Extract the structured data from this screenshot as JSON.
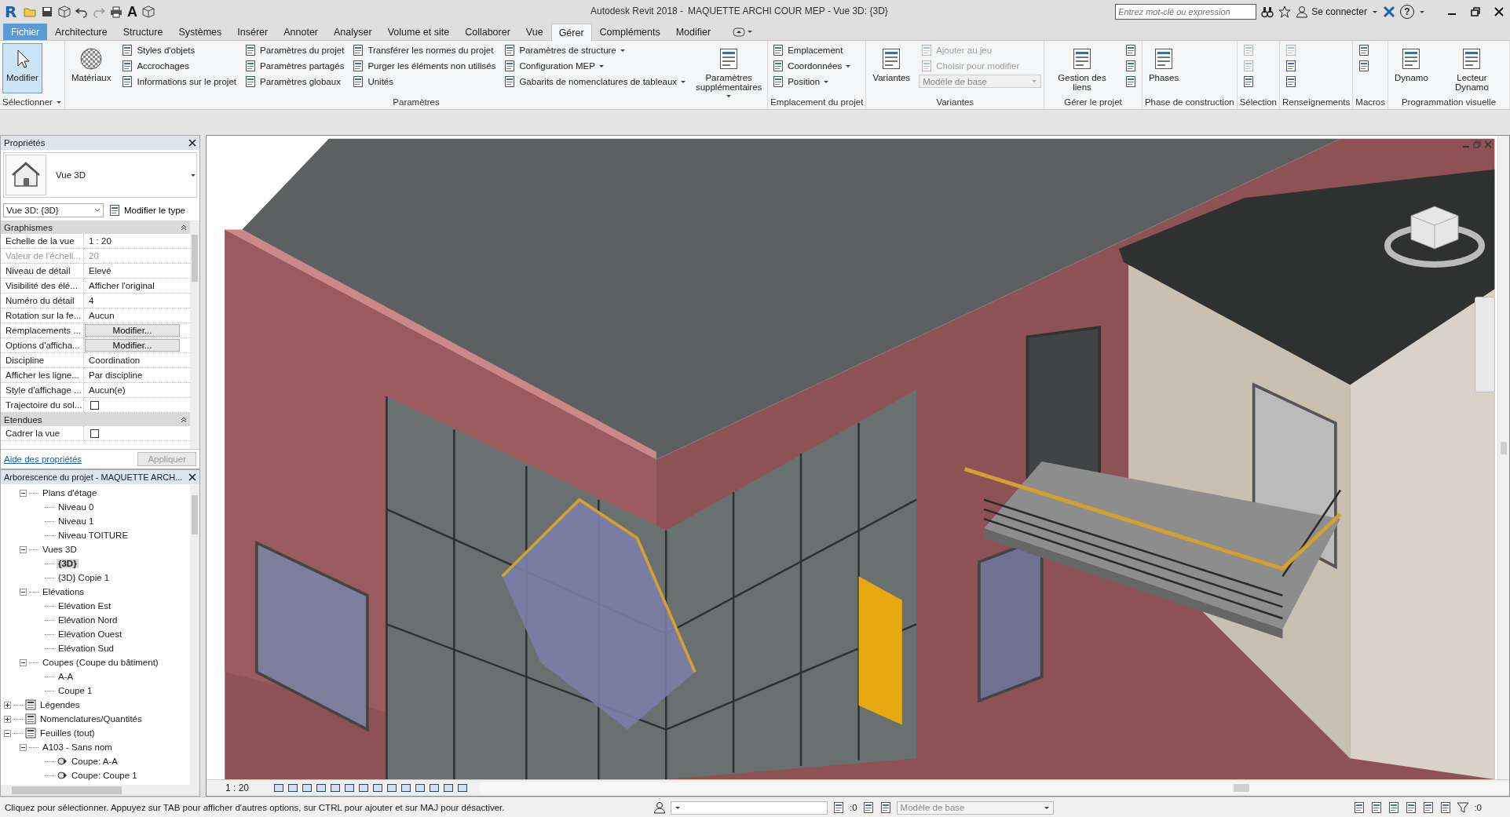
{
  "title_bar": {
    "logo": "R",
    "text_tool": "A",
    "app_title": "Autodesk Revit 2018 -",
    "document_title": "MAQUETTE ARCHI COUR MEP - Vue 3D: {3D}",
    "search": {
      "placeholder": "Entrez mot-clé ou expression"
    },
    "sign_in": "Se connecter",
    "help": "?"
  },
  "ribbon_tabs": [
    {
      "label": "Fichier",
      "kind": "file",
      "selected": false
    },
    {
      "label": "Architecture",
      "kind": "tab",
      "selected": false
    },
    {
      "label": "Structure",
      "kind": "tab",
      "selected": false
    },
    {
      "label": "Systèmes",
      "kind": "tab",
      "selected": false
    },
    {
      "label": "Insérer",
      "kind": "tab",
      "selected": false
    },
    {
      "label": "Annoter",
      "kind": "tab",
      "selected": false
    },
    {
      "label": "Analyser",
      "kind": "tab",
      "selected": false
    },
    {
      "label": "Volume et site",
      "kind": "tab",
      "selected": false
    },
    {
      "label": "Collaborer",
      "kind": "tab",
      "selected": false
    },
    {
      "label": "Vue",
      "kind": "tab",
      "selected": false
    },
    {
      "label": "Gérer",
      "kind": "tab",
      "selected": true
    },
    {
      "label": "Compléments",
      "kind": "tab",
      "selected": false
    },
    {
      "label": "Modifier",
      "kind": "tab",
      "selected": false
    }
  ],
  "ribbon_panels": [
    {
      "title": "Sélectionner",
      "dropdown": true,
      "columns": [
        [
          {
            "kind": "toggle",
            "label": "Modifier",
            "active": true,
            "disabled": false
          }
        ]
      ]
    },
    {
      "title": "Paramètres",
      "columns": [
        [
          {
            "kind": "large",
            "label": "Matériaux",
            "disabled": false
          }
        ],
        [
          {
            "kind": "small",
            "label": "Styles d'objets",
            "disabled": false
          },
          {
            "kind": "small",
            "label": "Accrochages",
            "disabled": false
          },
          {
            "kind": "small",
            "label": "Informations sur le projet",
            "disabled": false
          }
        ],
        [
          {
            "kind": "small",
            "label": "Paramètres du projet",
            "disabled": false
          },
          {
            "kind": "small",
            "label": "Paramètres partagés",
            "disabled": false
          },
          {
            "kind": "small",
            "label": "Paramètres globaux",
            "disabled": false
          }
        ],
        [
          {
            "kind": "small",
            "label": "Transférer les normes du projet",
            "disabled": false
          },
          {
            "kind": "small",
            "label": "Purger les éléments non utilisés",
            "disabled": false
          },
          {
            "kind": "small",
            "label": "Unités",
            "disabled": false
          }
        ],
        [
          {
            "kind": "small",
            "label": "Paramètres de structure",
            "dropdown": true,
            "disabled": false
          },
          {
            "kind": "small",
            "label": "Configuration MEP",
            "dropdown": true,
            "disabled": false
          },
          {
            "kind": "small",
            "label": "Gabarits de nomenclatures de tableaux",
            "dropdown": true,
            "disabled": false
          }
        ],
        [
          {
            "kind": "large",
            "label": "Paramètres supplémentaires",
            "dropdown": true,
            "disabled": false
          }
        ]
      ]
    },
    {
      "title": "Emplacement du projet",
      "columns": [
        [
          {
            "kind": "small",
            "label": "Emplacement",
            "disabled": false
          },
          {
            "kind": "small",
            "label": "Coordonnées",
            "dropdown": true,
            "disabled": false
          },
          {
            "kind": "small",
            "label": "Position",
            "dropdown": true,
            "disabled": false
          }
        ]
      ]
    },
    {
      "title": "Variantes",
      "columns": [
        [
          {
            "kind": "large",
            "label": "Variantes",
            "disabled": false
          }
        ],
        [
          {
            "kind": "small",
            "label": "Ajouter au jeu",
            "disabled": true
          },
          {
            "kind": "small",
            "label": "Choisir pour modifier",
            "disabled": true
          },
          {
            "kind": "combo",
            "label": "Modèle de base",
            "disabled": true
          }
        ]
      ]
    },
    {
      "title": "Gérer le projet",
      "columns": [
        [
          {
            "kind": "large",
            "label": "Gestion des liens",
            "disabled": false
          }
        ],
        [
          {
            "kind": "icon",
            "disabled": false
          },
          {
            "kind": "icon",
            "disabled": false
          },
          {
            "kind": "icon",
            "disabled": false
          }
        ]
      ]
    },
    {
      "title": "Phase de construction",
      "columns": [
        [
          {
            "kind": "large",
            "label": "Phases",
            "disabled": false
          }
        ]
      ]
    },
    {
      "title": "Sélection",
      "columns": [
        [
          {
            "kind": "icon",
            "disabled": true
          },
          {
            "kind": "icon",
            "disabled": true
          },
          {
            "kind": "icon",
            "disabled": false
          }
        ]
      ]
    },
    {
      "title": "Renseignements",
      "columns": [
        [
          {
            "kind": "icon",
            "disabled": true
          },
          {
            "kind": "icon",
            "disabled": false
          },
          {
            "kind": "icon",
            "disabled": false
          }
        ]
      ]
    },
    {
      "title": "Macros",
      "columns": [
        [
          {
            "kind": "icon",
            "disabled": false
          },
          {
            "kind": "icon",
            "disabled": false
          }
        ]
      ]
    },
    {
      "title": "Programmation visuelle",
      "columns": [
        [
          {
            "kind": "large",
            "label": "Dynamo",
            "disabled": false
          }
        ],
        [
          {
            "kind": "large",
            "label": "Lecteur Dynamo",
            "disabled": false
          }
        ]
      ]
    }
  ],
  "properties": {
    "title": "Propriétés",
    "type_name": "Vue 3D",
    "instance_selector": "Vue 3D: {3D}",
    "edit_type": "Modifier le type",
    "groups": [
      {
        "title": "Graphismes",
        "rows": [
          {
            "kind": "text",
            "name": "Echelle de la vue",
            "value": "1 : 20",
            "disabled": false
          },
          {
            "kind": "text",
            "name": "Valeur de l'échell...",
            "value": "20",
            "disabled": true
          },
          {
            "kind": "text",
            "name": "Niveau de détail",
            "value": "Elevé",
            "disabled": false
          },
          {
            "kind": "text",
            "name": "Visibilité des élé...",
            "value": "Afficher l'original",
            "disabled": false
          },
          {
            "kind": "text",
            "name": "Numéro du détail",
            "value": "4",
            "disabled": false
          },
          {
            "kind": "text",
            "name": "Rotation sur la fe...",
            "value": "Aucun",
            "disabled": false
          },
          {
            "kind": "button",
            "name": "Remplacements ...",
            "value": "Modifier...",
            "disabled": false
          },
          {
            "kind": "button",
            "name": "Options d'afficha...",
            "value": "Modifier...",
            "disabled": false
          },
          {
            "kind": "text",
            "name": "Discipline",
            "value": "Coordination",
            "disabled": false
          },
          {
            "kind": "text",
            "name": "Afficher les ligne...",
            "value": "Par discipline",
            "disabled": false
          },
          {
            "kind": "text",
            "name": "Style d'affichage ...",
            "value": "Aucun(e)",
            "disabled": false
          },
          {
            "kind": "checkbox",
            "name": "Trajectoire du sol...",
            "checked": false,
            "disabled": false
          }
        ]
      },
      {
        "title": "Etendues",
        "rows": [
          {
            "kind": "checkbox",
            "name": "Cadrer la vue",
            "checked": false,
            "disabled": false
          }
        ]
      }
    ],
    "help_link": "Aide des propriétés",
    "apply": {
      "label": "Appliquer",
      "disabled": true
    }
  },
  "project_browser": {
    "title": "Arborescence du projet - MAQUETTE ARCH...",
    "tree": [
      {
        "kind": "hidden",
        "children": [
          {
            "kind": "folder",
            "label": "Plans d'étage",
            "expanded": true,
            "selected": false,
            "children": [
              {
                "kind": "leaf",
                "label": "Niveau 0",
                "selected": false
              },
              {
                "kind": "leaf",
                "label": "Niveau 1",
                "selected": false
              },
              {
                "kind": "leaf",
                "label": "Niveau TOITURE",
                "selected": false
              }
            ]
          },
          {
            "kind": "folder",
            "label": "Vues 3D",
            "expanded": true,
            "selected": false,
            "children": [
              {
                "kind": "leaf",
                "label": "{3D}",
                "selected": true
              },
              {
                "kind": "leaf",
                "label": "{3D} Copie 1",
                "selected": false
              }
            ]
          },
          {
            "kind": "folder",
            "label": "Elévations",
            "expanded": true,
            "selected": false,
            "children": [
              {
                "kind": "leaf",
                "label": "Elévation Est",
                "selected": false
              },
              {
                "kind": "leaf",
                "label": "Elévation Nord",
                "selected": false
              },
              {
                "kind": "leaf",
                "label": "Elévation Ouest",
                "selected": false
              },
              {
                "kind": "leaf",
                "label": "Elévation Sud",
                "selected": false
              }
            ]
          },
          {
            "kind": "folder",
            "label": "Coupes (Coupe du bâtiment)",
            "expanded": true,
            "selected": false,
            "children": [
              {
                "kind": "leaf",
                "label": "A-A",
                "selected": false
              },
              {
                "kind": "leaf",
                "label": "Coupe 1",
                "selected": false
              }
            ]
          }
        ]
      },
      {
        "kind": "category",
        "label": "Légendes",
        "expanded": false,
        "selected": false
      },
      {
        "kind": "category",
        "label": "Nomenclatures/Quantités",
        "expanded": false,
        "selected": false
      },
      {
        "kind": "category",
        "label": "Feuilles (tout)",
        "expanded": true,
        "selected": false,
        "children": [
          {
            "kind": "folder",
            "label": "A103 - Sans nom",
            "expanded": true,
            "selected": false,
            "children": [
              {
                "kind": "view",
                "label": "Coupe: A-A",
                "selected": false
              },
              {
                "kind": "view",
                "label": "Coupe: Coupe 1",
                "selected": false
              }
            ]
          }
        ]
      }
    ]
  },
  "view_bar": {
    "scale": "1 : 20"
  },
  "status_bar": {
    "message": "Cliquez pour sélectionner. Appuyez sur TAB pour afficher d'autres options, sur CTRL pour ajouter et sur MAJ pour désactiver.",
    "editable_count": ":0",
    "workset": {
      "label": "Modèle de base",
      "disabled": true
    },
    "filter_count": ":0"
  }
}
